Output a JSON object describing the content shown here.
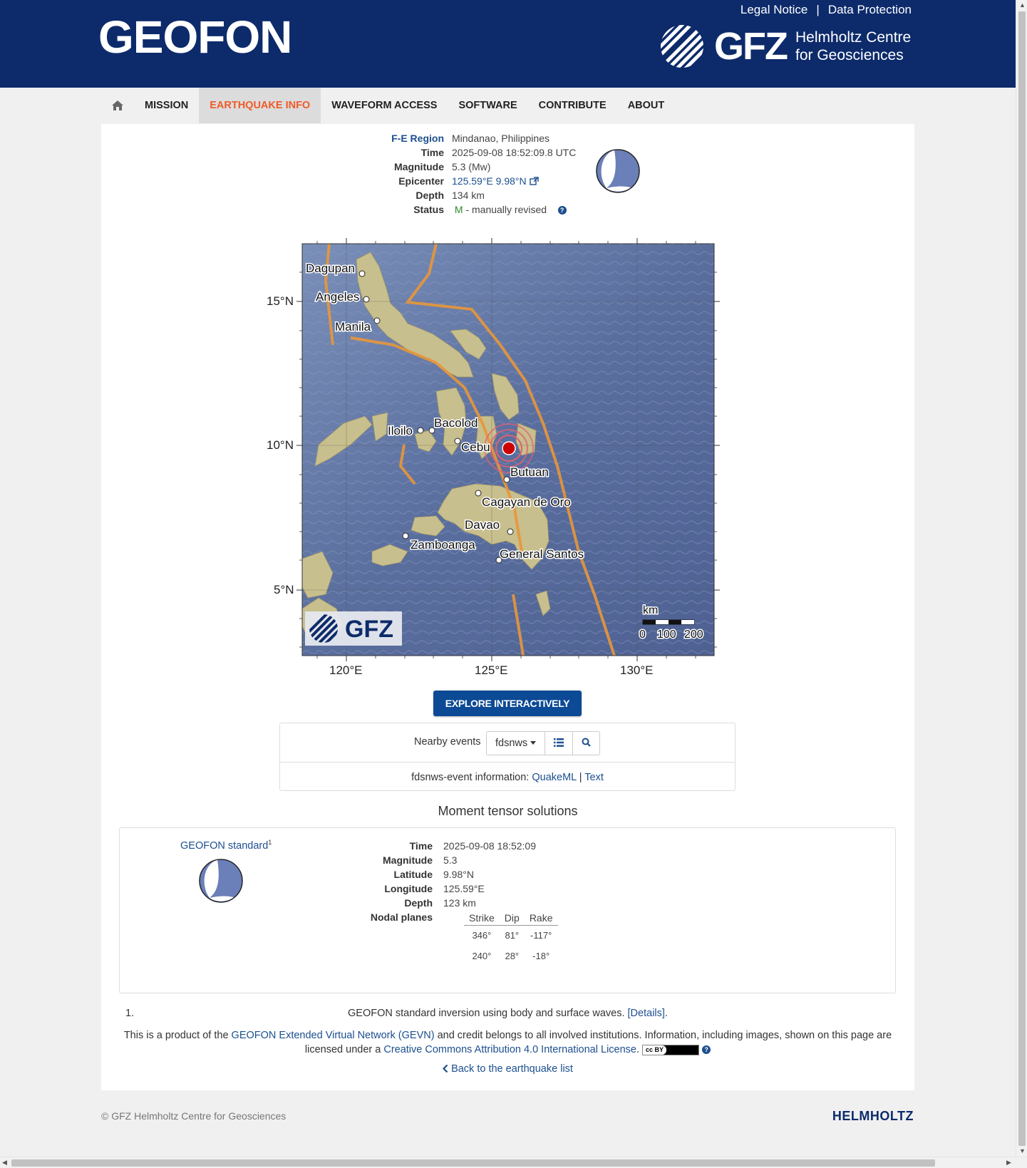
{
  "header": {
    "brand": "GEOFON",
    "legal_notice": "Legal Notice",
    "separator": "|",
    "data_protection": "Data Protection",
    "gfz_word": "GFZ",
    "gfz_sub_line1": "Helmholtz Centre",
    "gfz_sub_line2": "for Geosciences"
  },
  "nav": {
    "home_icon": "home-icon",
    "items": [
      "MISSION",
      "EARTHQUAKE INFO",
      "WAVEFORM ACCESS",
      "SOFTWARE",
      "CONTRIBUTE",
      "ABOUT"
    ],
    "active": "EARTHQUAKE INFO"
  },
  "event": {
    "fe_region_label": "F-E Region",
    "fe_region": "Mindanao, Philippines",
    "time_label": "Time",
    "time": "2025-09-08 18:52:09.8 UTC",
    "magnitude_label": "Magnitude",
    "magnitude": "5.3 (Mw)",
    "epicenter_label": "Epicenter",
    "epicenter": "125.59°E 9.98°N",
    "depth_label": "Depth",
    "depth": "134 km",
    "status_label": "Status",
    "status_code": "M",
    "status_text": " - manually revised"
  },
  "map": {
    "lat_labels": [
      "15°N",
      "10°N",
      "5°N"
    ],
    "lon_labels": [
      "120°E",
      "125°E",
      "130°E"
    ],
    "cities": [
      "Dagupan",
      "Angeles",
      "Manila",
      "Iloilo",
      "Bacolod",
      "Cebu",
      "Butuan",
      "Cagayan de Oro",
      "Davao",
      "Zamboanga",
      "General Santos"
    ],
    "scale_unit": "km",
    "scale_ticks": [
      "0",
      "100",
      "200"
    ],
    "logo_text": "GFZ"
  },
  "explore_button": "EXPLORE INTERACTIVELY",
  "nearby": {
    "label": "Nearby events",
    "service": "fdsnws",
    "list_icon": "list-icon",
    "search_icon": "search-icon",
    "info_prefix": "fdsnws-event information: ",
    "quakeml": "QuakeML",
    "sep": "|",
    "text": "Text"
  },
  "moment_tensor": {
    "title": "Moment tensor solutions",
    "solution_name": "GEOFON standard",
    "solution_sup": "1",
    "time_label": "Time",
    "time": "2025-09-08 18:52:09",
    "magnitude_label": "Magnitude",
    "magnitude": "5.3",
    "latitude_label": "Latitude",
    "latitude": "9.98°N",
    "longitude_label": "Longitude",
    "longitude": "125.59°E",
    "depth_label": "Depth",
    "depth": "123 km",
    "nodal_label": "Nodal planes",
    "nodal_headers": [
      "Strike",
      "Dip",
      "Rake"
    ],
    "nodal_rows": [
      [
        "346°",
        "81°",
        "-117°"
      ],
      [
        "240°",
        "28°",
        "-18°"
      ]
    ]
  },
  "footnote": {
    "num": "1.",
    "text": "GEOFON standard inversion using body and surface waves. ",
    "details": "[Details]",
    "period": "."
  },
  "license": {
    "part1": "This is a product of the ",
    "gevn": "GEOFON Extended Virtual Network (GEVN)",
    "part2": " and credit belongs to all involved institutions. Information, including images, shown on this page are licensed under a ",
    "cc_link": "Creative Commons Attribution 4.0 International License",
    "part3": ".",
    "cc_badge": "cc BY"
  },
  "back_link": "Back to the earthquake list",
  "footer": {
    "copyright": "© GFZ Helmholtz Centre for Geosciences",
    "helmholtz": "HELMHOLTZ"
  },
  "colors": {
    "header_bg": "#0d2b6b",
    "nav_active": "#f05a28",
    "link": "#1c4f8f",
    "button": "#0d4a96",
    "beachball_fill": "#6b7fb8"
  }
}
